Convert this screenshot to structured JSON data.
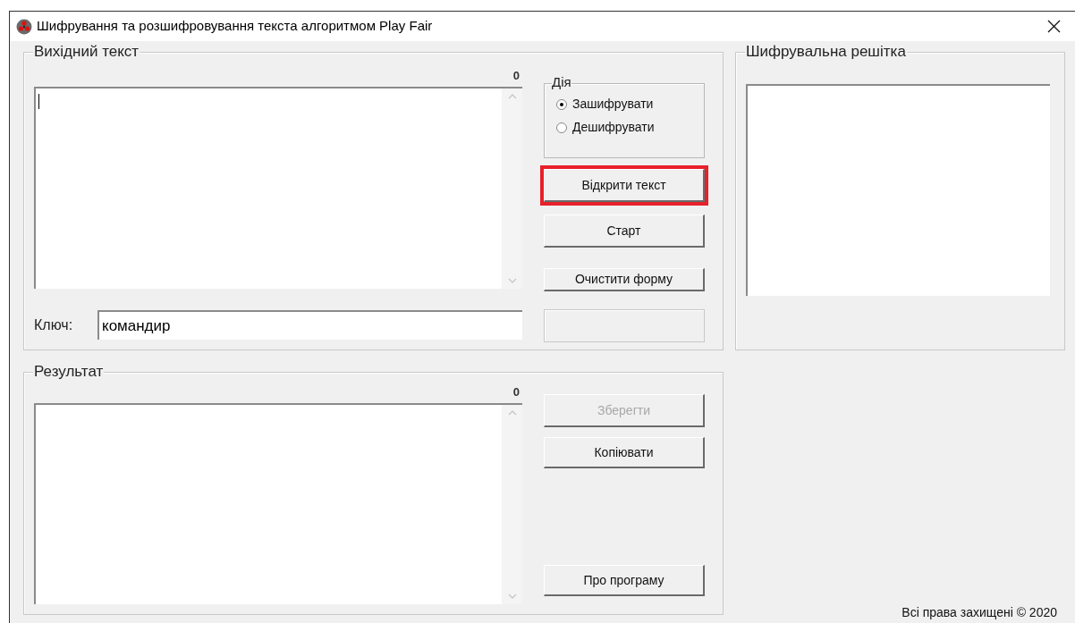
{
  "window": {
    "title": "Шифрування та розшифровування текста алгоритмом Play Fair"
  },
  "source": {
    "title": "Вихідний текст",
    "counter": "0",
    "key_label": "Ключ:",
    "key_value": "командир",
    "buttons": [
      {
        "label": "Відкрити текст",
        "highlighted": true,
        "disabled": false
      },
      {
        "label": "Старт",
        "highlighted": false,
        "disabled": false
      },
      {
        "label": "Очистити форму",
        "highlighted": false,
        "disabled": false
      }
    ]
  },
  "action": {
    "title": "Дія",
    "options": [
      {
        "label": "Зашифрувати",
        "selected": true
      },
      {
        "label": "Дешифрувати",
        "selected": false
      }
    ]
  },
  "grid": {
    "title": "Шифрувальна решітка"
  },
  "result": {
    "title": "Результат",
    "counter": "0",
    "buttons": [
      {
        "label": "Зберегти",
        "highlighted": false,
        "disabled": true
      },
      {
        "label": "Копіювати",
        "highlighted": false,
        "disabled": false
      }
    ],
    "about_button": {
      "label": "Про програму",
      "highlighted": false,
      "disabled": false
    }
  },
  "footer": "Всі права захищені © 2020"
}
